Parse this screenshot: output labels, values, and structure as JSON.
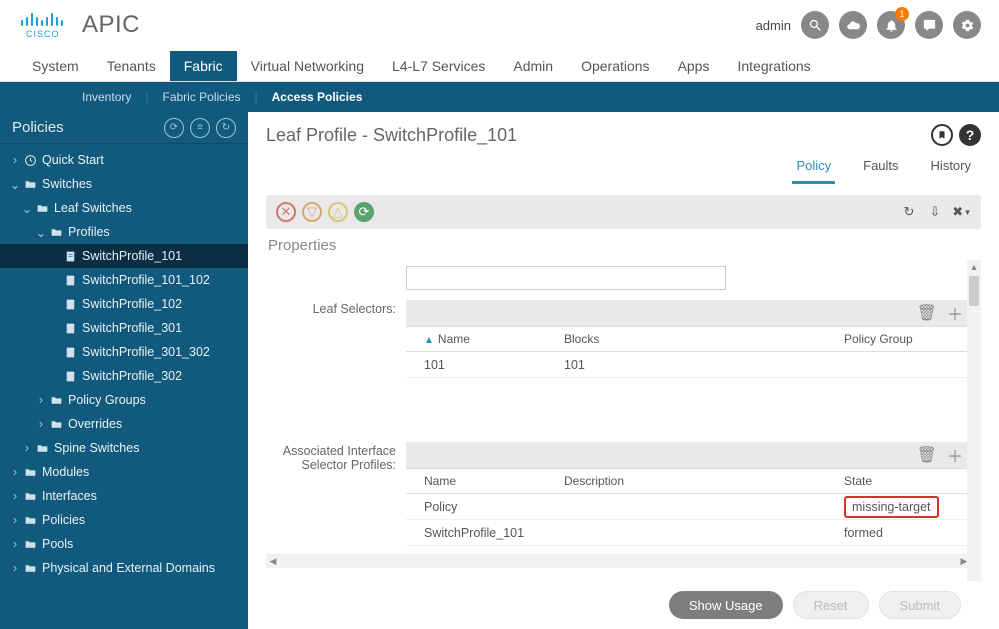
{
  "header": {
    "app_name": "APIC",
    "user": "admin",
    "notification_badge": "1"
  },
  "mainnav": {
    "items": [
      "System",
      "Tenants",
      "Fabric",
      "Virtual Networking",
      "L4-L7 Services",
      "Admin",
      "Operations",
      "Apps",
      "Integrations"
    ],
    "active_index": 2
  },
  "subnav": {
    "items": [
      "Inventory",
      "Fabric Policies",
      "Access Policies"
    ],
    "active_index": 2
  },
  "sidebar": {
    "title": "Policies",
    "tree": {
      "quick_start": "Quick Start",
      "switches": "Switches",
      "leaf_switches": "Leaf Switches",
      "profiles": "Profiles",
      "profile_items": [
        "SwitchProfile_101",
        "SwitchProfile_101_102",
        "SwitchProfile_102",
        "SwitchProfile_301",
        "SwitchProfile_301_302",
        "SwitchProfile_302"
      ],
      "policy_groups": "Policy Groups",
      "overrides": "Overrides",
      "spine_switches": "Spine Switches",
      "modules": "Modules",
      "interfaces": "Interfaces",
      "policies": "Policies",
      "pools": "Pools",
      "phys_ext": "Physical and External Domains"
    }
  },
  "page": {
    "title": "Leaf Profile - SwitchProfile_101",
    "tabs": [
      "Policy",
      "Faults",
      "History"
    ],
    "active_tab": 0
  },
  "panel": {
    "section_title": "Properties",
    "leaf_selectors": {
      "label": "Leaf Selectors:",
      "columns": [
        "Name",
        "Blocks",
        "Policy Group"
      ],
      "rows": [
        {
          "name": "101",
          "blocks": "101",
          "policy_group": ""
        }
      ]
    },
    "assoc_profiles": {
      "label_l1": "Associated Interface",
      "label_l2": "Selector Profiles:",
      "columns": [
        "Name",
        "Description",
        "State"
      ],
      "rows": [
        {
          "name": "Policy",
          "description": "",
          "state": "missing-target",
          "highlight": true
        },
        {
          "name": "SwitchProfile_101",
          "description": "",
          "state": "formed",
          "highlight": false
        }
      ]
    }
  },
  "footer": {
    "show_usage": "Show Usage",
    "reset": "Reset",
    "submit": "Submit"
  }
}
